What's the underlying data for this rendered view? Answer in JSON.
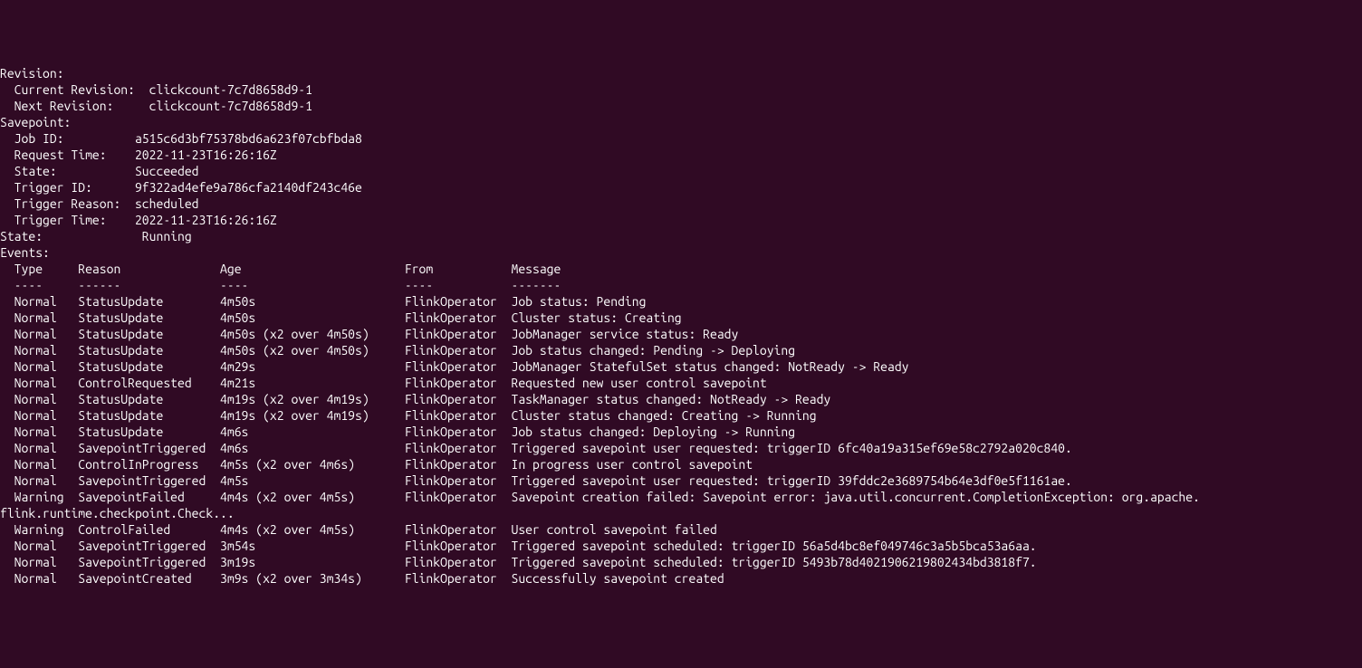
{
  "revision": {
    "header": "Revision:",
    "current_label": "  Current Revision:  ",
    "current_value": "clickcount-7c7d8658d9-1",
    "next_label": "  Next Revision:     ",
    "next_value": "clickcount-7c7d8658d9-1"
  },
  "savepoint": {
    "header": "Savepoint:",
    "job_id_label": "  Job ID:          ",
    "job_id_value": "a515c6d3bf75378bd6a623f07cbfbda8",
    "request_time_label": "  Request Time:    ",
    "request_time_value": "2022-11-23T16:26:16Z",
    "state_label": "  State:           ",
    "state_value": "Succeeded",
    "trigger_id_label": "  Trigger ID:      ",
    "trigger_id_value": "9f322ad4efe9a786cfa2140df243c46e",
    "trigger_reason_label": "  Trigger Reason:  ",
    "trigger_reason_value": "scheduled",
    "trigger_time_label": "  Trigger Time:    ",
    "trigger_time_value": "2022-11-23T16:26:16Z"
  },
  "state_label": "State:              ",
  "state_value": "Running",
  "events_header": "Events:",
  "columns": {
    "type": "  Type     ",
    "reason": "Reason              ",
    "age": "Age                       ",
    "from": "From           ",
    "message": "Message"
  },
  "dashes": {
    "type": "  ----     ",
    "reason": "------              ",
    "age": "----                      ",
    "from": "----           ",
    "message": "-------"
  },
  "events": [
    {
      "type": "  Normal   ",
      "reason": "StatusUpdate        ",
      "age": "4m50s                     ",
      "from": "FlinkOperator  ",
      "message": "Job status: Pending"
    },
    {
      "type": "  Normal   ",
      "reason": "StatusUpdate        ",
      "age": "4m50s                     ",
      "from": "FlinkOperator  ",
      "message": "Cluster status: Creating"
    },
    {
      "type": "  Normal   ",
      "reason": "StatusUpdate        ",
      "age": "4m50s (x2 over 4m50s)     ",
      "from": "FlinkOperator  ",
      "message": "JobManager service status: Ready"
    },
    {
      "type": "  Normal   ",
      "reason": "StatusUpdate        ",
      "age": "4m50s (x2 over 4m50s)     ",
      "from": "FlinkOperator  ",
      "message": "Job status changed: Pending -> Deploying"
    },
    {
      "type": "  Normal   ",
      "reason": "StatusUpdate        ",
      "age": "4m29s                     ",
      "from": "FlinkOperator  ",
      "message": "JobManager StatefulSet status changed: NotReady -> Ready"
    },
    {
      "type": "  Normal   ",
      "reason": "ControlRequested    ",
      "age": "4m21s                     ",
      "from": "FlinkOperator  ",
      "message": "Requested new user control savepoint"
    },
    {
      "type": "  Normal   ",
      "reason": "StatusUpdate        ",
      "age": "4m19s (x2 over 4m19s)     ",
      "from": "FlinkOperator  ",
      "message": "TaskManager status changed: NotReady -> Ready"
    },
    {
      "type": "  Normal   ",
      "reason": "StatusUpdate        ",
      "age": "4m19s (x2 over 4m19s)     ",
      "from": "FlinkOperator  ",
      "message": "Cluster status changed: Creating -> Running"
    },
    {
      "type": "  Normal   ",
      "reason": "StatusUpdate        ",
      "age": "4m6s                      ",
      "from": "FlinkOperator  ",
      "message": "Job status changed: Deploying -> Running"
    },
    {
      "type": "  Normal   ",
      "reason": "SavepointTriggered  ",
      "age": "4m6s                      ",
      "from": "FlinkOperator  ",
      "message": "Triggered savepoint user requested: triggerID 6fc40a19a315ef69e58c2792a020c840."
    },
    {
      "type": "  Normal   ",
      "reason": "ControlInProgress   ",
      "age": "4m5s (x2 over 4m6s)       ",
      "from": "FlinkOperator  ",
      "message": "In progress user control savepoint"
    },
    {
      "type": "  Normal   ",
      "reason": "SavepointTriggered  ",
      "age": "4m5s                      ",
      "from": "FlinkOperator  ",
      "message": "Triggered savepoint user requested: triggerID 39fddc2e3689754b64e3df0e5f1161ae."
    },
    {
      "type": "  Warning  ",
      "reason": "SavepointFailed     ",
      "age": "4m4s (x2 over 4m5s)       ",
      "from": "FlinkOperator  ",
      "message": "Savepoint creation failed: Savepoint error: java.util.concurrent.CompletionException: org.apache."
    }
  ],
  "wrap_line": "flink.runtime.checkpoint.Check...",
  "events2": [
    {
      "type": "  Warning  ",
      "reason": "ControlFailed       ",
      "age": "4m4s (x2 over 4m5s)       ",
      "from": "FlinkOperator  ",
      "message": "User control savepoint failed"
    },
    {
      "type": "  Normal   ",
      "reason": "SavepointTriggered  ",
      "age": "3m54s                     ",
      "from": "FlinkOperator  ",
      "message": "Triggered savepoint scheduled: triggerID 56a5d4bc8ef049746c3a5b5bca53a6aa."
    },
    {
      "type": "  Normal   ",
      "reason": "SavepointTriggered  ",
      "age": "3m19s                     ",
      "from": "FlinkOperator  ",
      "message": "Triggered savepoint scheduled: triggerID 5493b78d4021906219802434bd3818f7."
    },
    {
      "type": "  Normal   ",
      "reason": "SavepointCreated    ",
      "age": "3m9s (x2 over 3m34s)      ",
      "from": "FlinkOperator  ",
      "message": "Successfully savepoint created"
    }
  ]
}
